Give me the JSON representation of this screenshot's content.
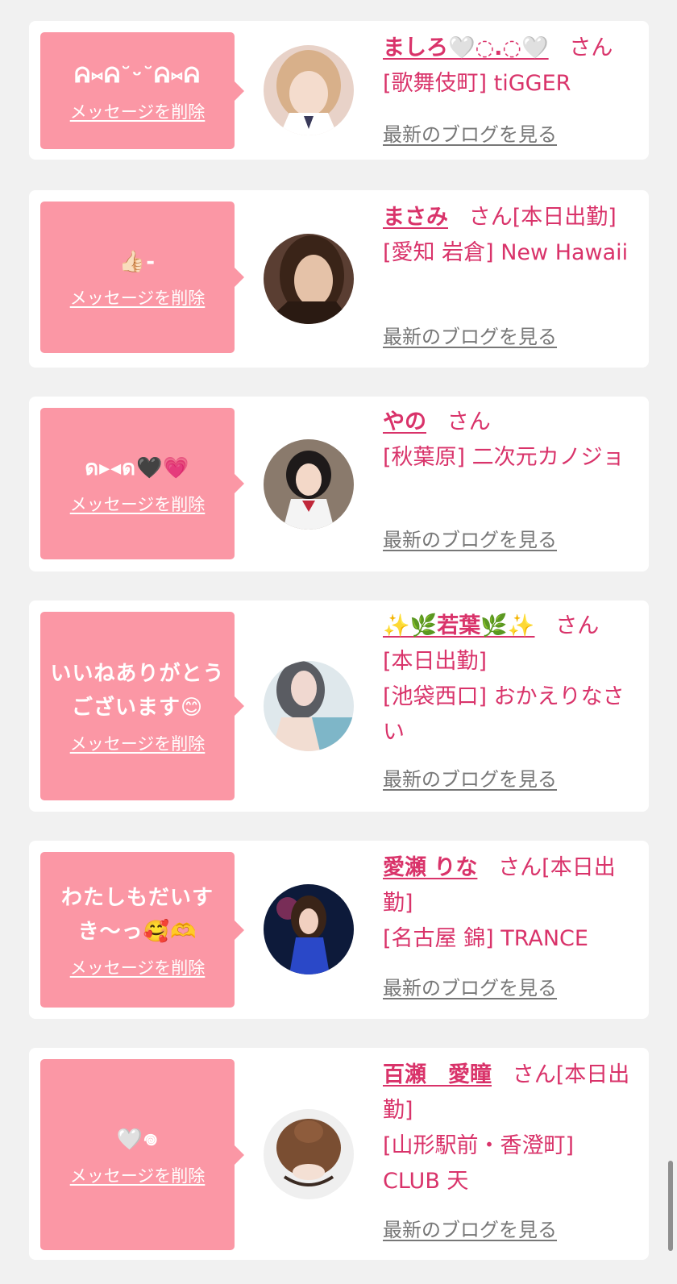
{
  "delete_label": "メッセージを削除",
  "blog_label": "最新のブログを見る",
  "colors": {
    "background": "#f1f1f1",
    "card": "#ffffff",
    "bubble": "#fb97a5",
    "accent": "#d9336a",
    "link_gray": "#777777"
  },
  "items": [
    {
      "message": "ᕱ⑅ᕱ˘ᵕ˘ᕱ⑅ᕱ",
      "name": "ましろ🤍◌.◌🤍",
      "san": "さん",
      "shop": "[歌舞伎町] tiGGER",
      "avatar_icon": "girl-photo-avatar"
    },
    {
      "message": "👍🏻-",
      "name": "まさみ",
      "san": "さん[本日出勤]",
      "shop": "[愛知 岩倉] New Hawaii",
      "avatar_icon": "girl-photo-avatar"
    },
    {
      "message": "ด▸◂ด🖤💗",
      "name": "やの",
      "san": "さん",
      "shop": "[秋葉原] 二次元カノジョ",
      "avatar_icon": "girl-photo-avatar"
    },
    {
      "message": "いいねありがとうございます😊",
      "name": "✨🌿若葉🌿✨",
      "san": "さん",
      "tag": "[本日出勤]",
      "shop": "[池袋西口] おかえりなさい",
      "avatar_icon": "girl-photo-avatar"
    },
    {
      "message": "わたしもだいすき〜っ🥰🫶",
      "name": "愛瀬 りな",
      "san": "さん[本日出勤]",
      "shop": "[名古屋 錦] TRANCE",
      "avatar_icon": "girl-photo-avatar"
    },
    {
      "message": "🤍𖦹",
      "name": "百瀬　愛瞳",
      "san": "さん[本日出勤]",
      "shop": "[山形駅前・香澄町] CLUB 天",
      "avatar_icon": "girl-photo-avatar"
    }
  ]
}
